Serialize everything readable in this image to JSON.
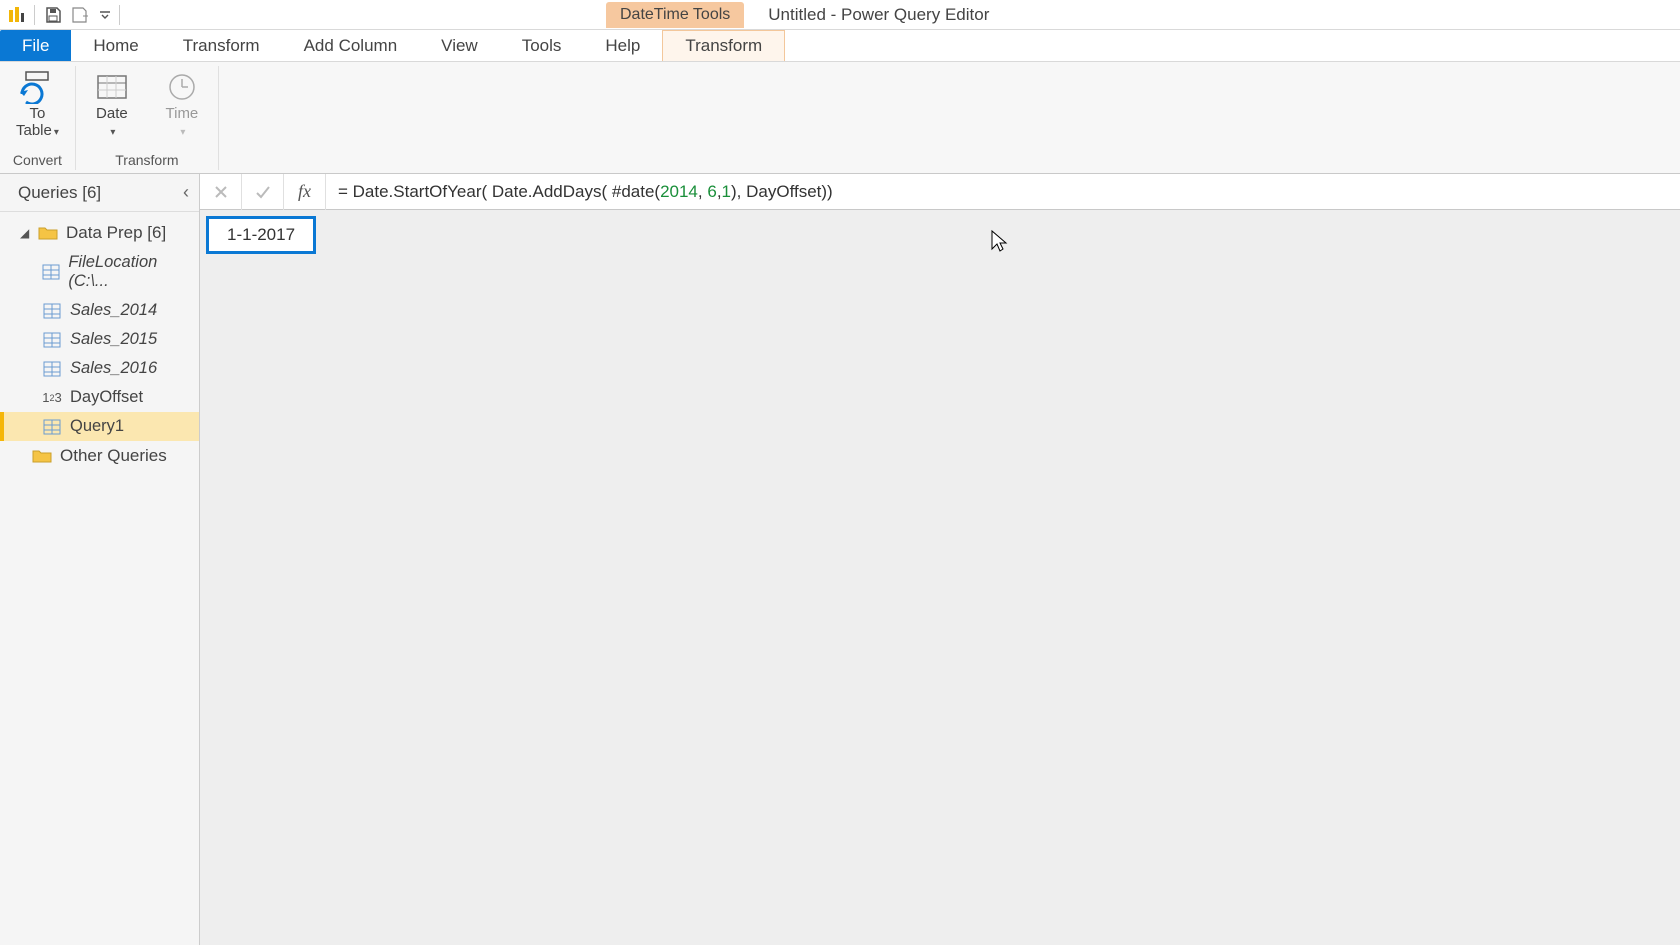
{
  "titlebar": {
    "context_group": "DateTime Tools",
    "window_title": "Untitled - Power Query Editor"
  },
  "tabs": {
    "file": "File",
    "home": "Home",
    "transform": "Transform",
    "add_column": "Add Column",
    "view": "View",
    "tools": "Tools",
    "help": "Help",
    "context_transform": "Transform"
  },
  "ribbon": {
    "convert": {
      "to_table": "To\nTable",
      "dropdown_caret": "▾",
      "group": "Convert"
    },
    "transform": {
      "date": "Date",
      "time": "Time",
      "group": "Transform"
    }
  },
  "sidebar": {
    "header": "Queries [6]",
    "groups": [
      {
        "label": "Data Prep [6]",
        "expanded": true,
        "items": [
          {
            "label": "FileLocation (C:\\...",
            "kind": "table",
            "italic": true
          },
          {
            "label": "Sales_2014",
            "kind": "table",
            "italic": true
          },
          {
            "label": "Sales_2015",
            "kind": "table",
            "italic": true
          },
          {
            "label": "Sales_2016",
            "kind": "table",
            "italic": true
          },
          {
            "label": "DayOffset",
            "kind": "number",
            "italic": false
          },
          {
            "label": "Query1",
            "kind": "table",
            "italic": false,
            "selected": true
          }
        ]
      },
      {
        "label": "Other Queries",
        "expanded": false,
        "items": []
      }
    ]
  },
  "formula": {
    "prefix": "= Date.StartOfYear( Date.AddDays( #date(",
    "n1": "2014",
    "sep1": ", ",
    "n2": "6",
    "sep2": ",",
    "n3": "1",
    "suffix": "), DayOffset))"
  },
  "result_value": "1-1-2017"
}
